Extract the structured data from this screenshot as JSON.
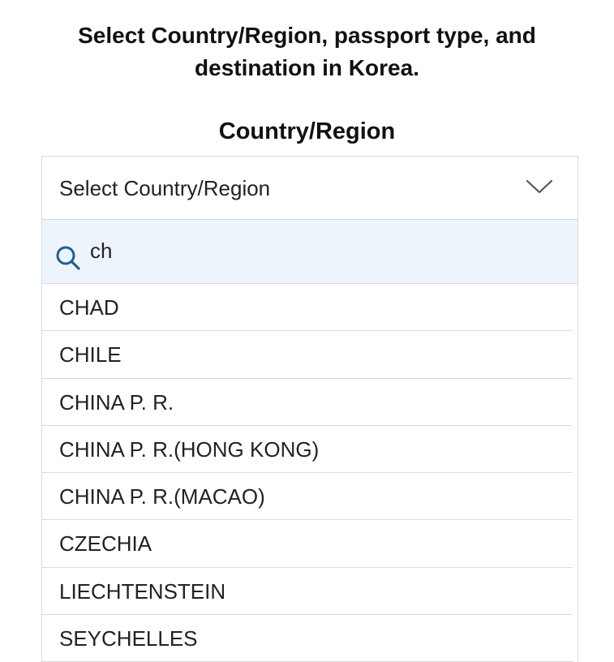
{
  "heading": {
    "line1": "Select Country/Region, passport type, and",
    "line2": "destination in Korea."
  },
  "country_field": {
    "label": "Country/Region",
    "selected_text": "Select Country/Region",
    "dropdown_icon": "chevron-down-icon"
  },
  "search": {
    "icon": "search-icon",
    "value": "ch"
  },
  "options": [
    "CHAD",
    "CHILE",
    "CHINA P. R.",
    "CHINA P. R.(HONG KONG)",
    "CHINA P. R.(MACAO)",
    "CZECHIA",
    "LIECHTENSTEIN",
    "SEYCHELLES"
  ],
  "colors": {
    "search_background": "#edf4fb",
    "search_icon": "#1f5f96"
  }
}
